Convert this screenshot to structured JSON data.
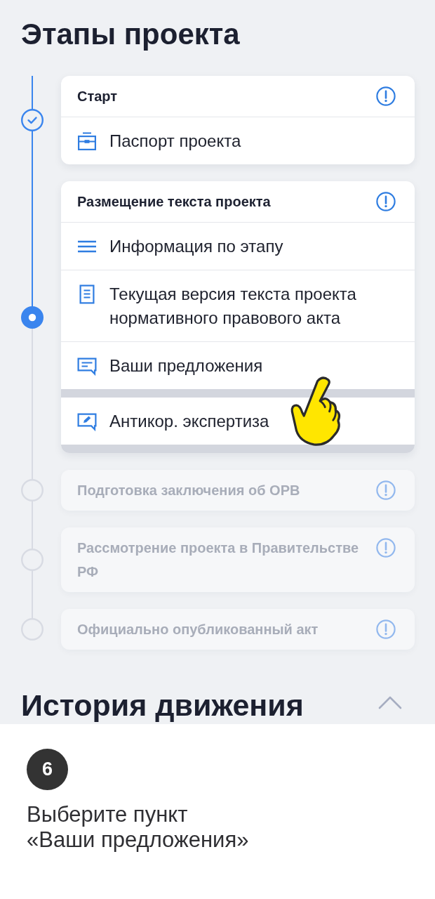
{
  "title": "Этапы проекта",
  "stages": [
    {
      "title": "Старт",
      "completed": true,
      "current": false,
      "items": [
        {
          "kind": "passport",
          "label": "Паспорт проекта",
          "raised": false,
          "pointer": false
        }
      ]
    },
    {
      "title": "Размещение текста проекта",
      "completed": false,
      "current": true,
      "items": [
        {
          "kind": "info",
          "label": "Информация по этапу",
          "raised": false,
          "pointer": false
        },
        {
          "kind": "text",
          "label": "Текущая версия текста проекта нормативного правового акта",
          "raised": false,
          "pointer": false
        },
        {
          "kind": "proposals",
          "label": "Ваши предложения",
          "raised": true,
          "pointer": true
        },
        {
          "kind": "expertise",
          "label": "Антикор. экспертиза",
          "raised": true,
          "pointer": false
        }
      ]
    },
    {
      "title": "Подготовка заключения об ОРВ",
      "completed": false,
      "current": false
    },
    {
      "title": "Рассмотрение проекта в Правительстве РФ",
      "completed": false,
      "current": false
    },
    {
      "title": "Официально опубликованный акт",
      "completed": false,
      "current": false
    }
  ],
  "history": {
    "title": "История движения",
    "expanded": true
  },
  "tutorial": {
    "step": "6",
    "text": "Выберите пункт\n«Ваши предложения»"
  }
}
